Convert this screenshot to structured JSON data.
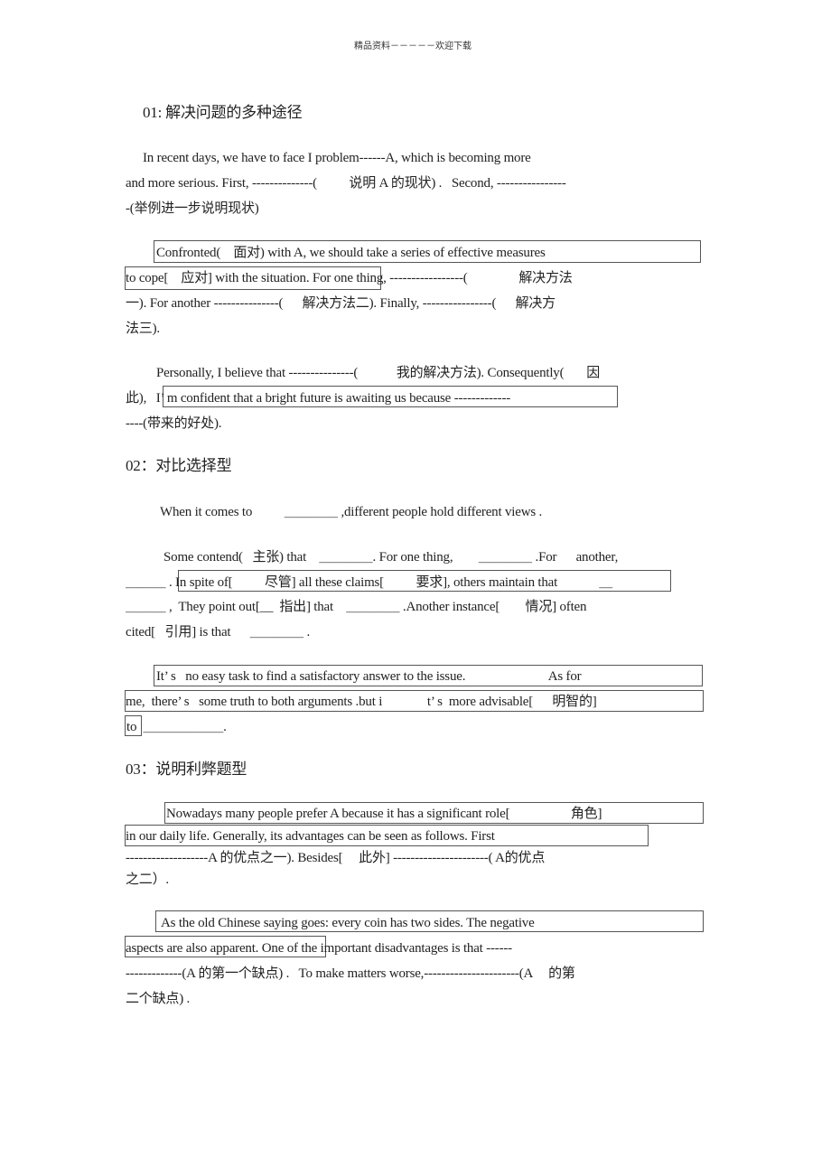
{
  "header": "精品资料－－－－－欢迎下载",
  "sections": [
    {
      "title": "01: 解决问题的多种途径",
      "lines": [
        "In recent days, we have to face I problem------A, which is becoming more",
        "and more serious. First, --------------(          说明 A 的现状) .   Second, ----------------",
        "-(举例进一步说明现状)",
        "Confronted(    面对) with A, we should take a series of effective measures",
        "to cope[    应对] with the situation. For one thing, -----------------(                解决方法",
        "一). For another ---------------(      解决方法二). Finally, ----------------(      解决方",
        "法三).",
        "Personally, I believe that ---------------(            我的解决方法). Consequently(       因",
        "此),   I’ m confident that a bright future is awaiting us because -------------",
        "----(带来的好处)."
      ]
    },
    {
      "title": "02：对比选择型",
      "lines": [
        "When it comes to          ＿＿＿＿ ,different people hold different views .",
        "Some contend(   主张) that    ＿＿＿＿. For one thing,        ＿＿＿＿ .For      another,",
        "＿＿＿ . In spite of[          尽管] all these claims[          要求], others maintain that             ＿",
        "＿＿＿ ,  They point out[__  指出] that    ＿＿＿＿ .Another instance[        情况] often",
        "cited[   引用] is that      ＿＿＿＿ .",
        "It’ s   no easy task to find a satisfactory answer to the issue.                          As for",
        "me,  there’ s   some truth to both arguments .but i              t’ s  more advisable[      明智的]",
        "to  ＿＿＿＿＿＿."
      ]
    },
    {
      "title": "03：说明利弊题型",
      "lines": [
        "Nowadays many people prefer A because it has a significant role[                   角色]",
        "in our daily life. Generally, its advantages can be seen as follows. First",
        "-------------------A 的优点之一). Besides[     此外] ----------------------( A的优点",
        "之二）.",
        "As the old Chinese saying goes: every coin has two sides. The negative",
        "aspects are also apparent. One of the important disadvantages is that ------",
        "-------------(A 的第一个缺点) .   To make matters worse,----------------------(A     的第",
        "二个缺点) ."
      ]
    }
  ]
}
